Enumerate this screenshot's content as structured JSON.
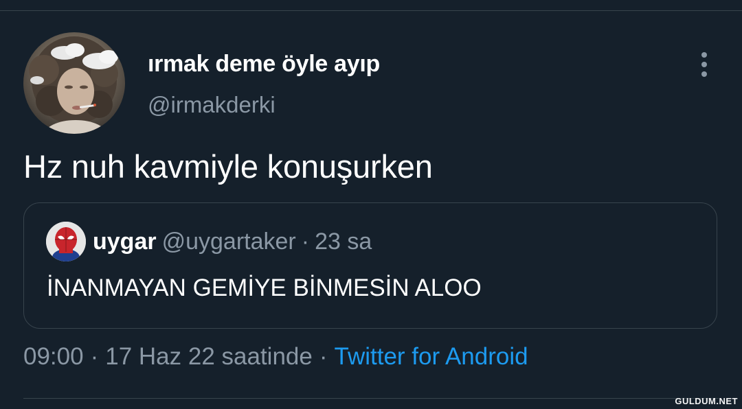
{
  "author": {
    "display_name": "ırmak deme öyle ayıp",
    "handle": "@irmakderki",
    "avatar_icon": "profile-photo"
  },
  "more_icon": "more-vertical-icon",
  "tweet": {
    "text": "Hz nuh kavmiyle konuşurken"
  },
  "quoted": {
    "name": "uygar",
    "handle": "@uygartaker",
    "separator": "·",
    "time": "23 sa",
    "text": "İNANMAYAN GEMİYE BİNMESİN ALOO",
    "avatar_icon": "spiderman-avatar"
  },
  "meta": {
    "time": "09:00",
    "dot1": "·",
    "date": "17 Haz 22 saatinde",
    "dot2": "·",
    "source": "Twitter for Android"
  },
  "watermark": "GULDUM.NET",
  "colors": {
    "background": "#15202b",
    "secondary_text": "#8b98a5",
    "link": "#1d9bf0",
    "border": "#38444d"
  }
}
